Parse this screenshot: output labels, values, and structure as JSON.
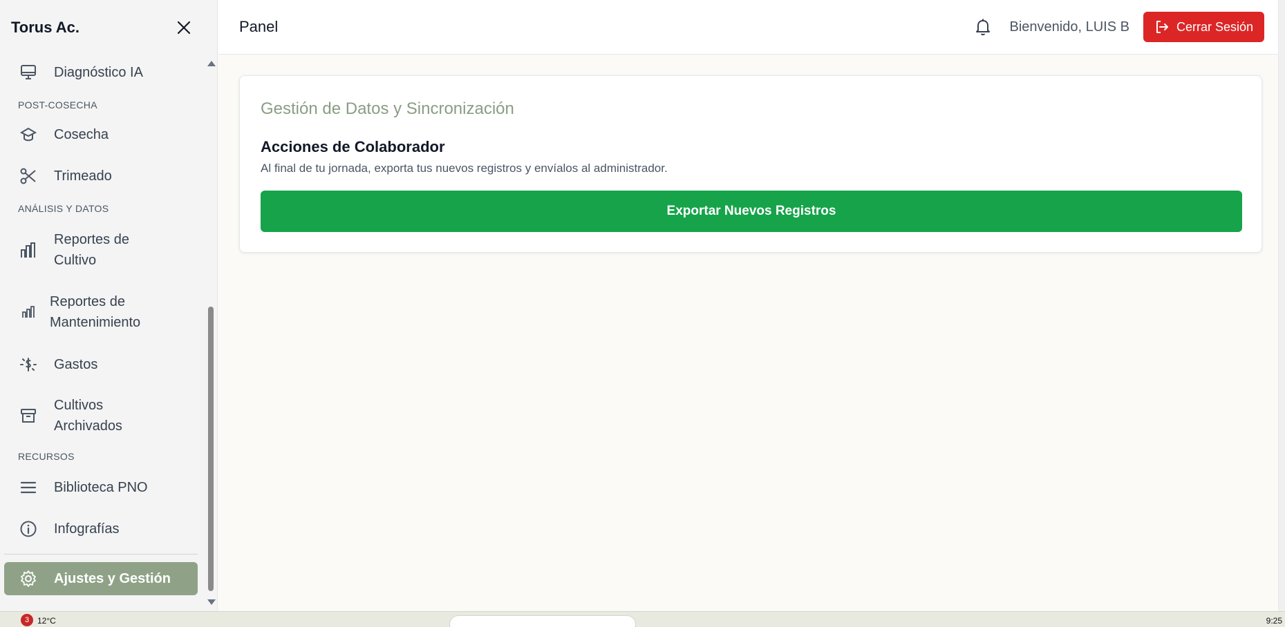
{
  "sidebar": {
    "brand": "Torus Ac.",
    "items": [
      {
        "label": "Diagnóstico IA",
        "icon": "monitor-icon"
      },
      {
        "label": "Cosecha",
        "icon": "harvest-icon"
      },
      {
        "label": "Trimeado",
        "icon": "scissors-icon"
      },
      {
        "label": "Reportes de Cultivo",
        "icon": "bar-chart-icon"
      },
      {
        "label": "Reportes de Mantenimiento",
        "icon": "bar-chart-small-icon"
      },
      {
        "label": "Gastos",
        "icon": "dollar-icon"
      },
      {
        "label": "Cultivos Archivados",
        "icon": "archive-icon"
      },
      {
        "label": "Biblioteca PNO",
        "icon": "menu-icon"
      },
      {
        "label": "Infografías",
        "icon": "info-icon"
      },
      {
        "label": "Ajustes y Gestión",
        "icon": "gear-icon",
        "active": true
      }
    ],
    "sections": {
      "post_harvest": "POST-COSECHA",
      "analysis": "ANÁLISIS Y DATOS",
      "resources": "RECURSOS"
    }
  },
  "header": {
    "title": "Panel",
    "welcome": "Bienvenido, LUIS B",
    "logout_label": "Cerrar Sesión"
  },
  "main": {
    "card_title": "Gestión de Datos y Sincronización",
    "subtitle": "Acciones de Colaborador",
    "description": "Al final de tu jornada, exporta tus nuevos registros y envíalos al administrador.",
    "export_label": "Exportar Nuevos Registros"
  },
  "taskbar": {
    "badge": "3",
    "temp": "12°C",
    "clock": "9:25"
  },
  "colors": {
    "accent": "#8fa287",
    "danger": "#dc2626",
    "success": "#16a34a",
    "title_green": "#8a9d84"
  }
}
